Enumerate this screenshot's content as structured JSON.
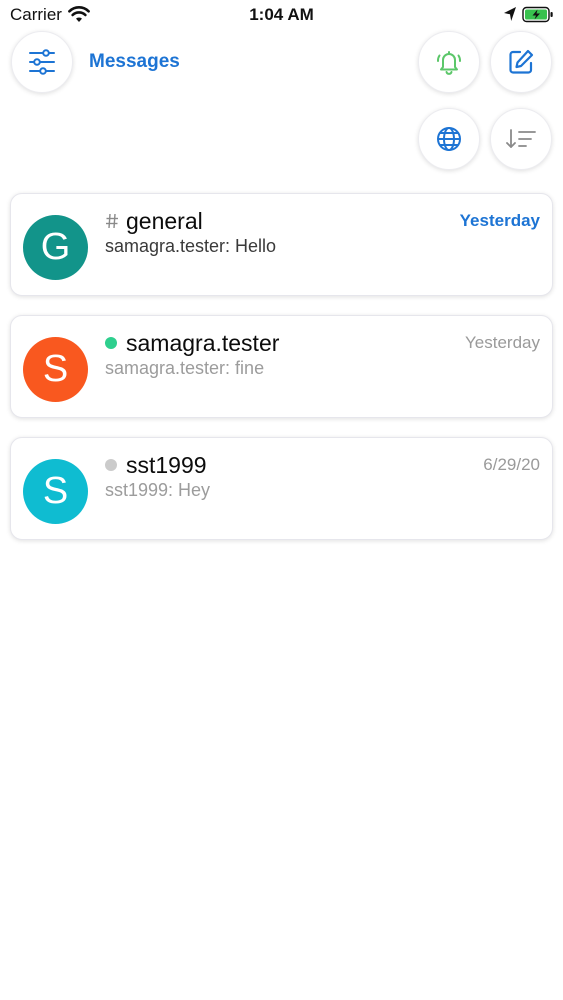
{
  "status_bar": {
    "carrier": "Carrier",
    "time": "1:04 AM",
    "icons": [
      "wifi-icon",
      "location-arrow-icon",
      "battery-charging-icon"
    ]
  },
  "header": {
    "title": "Messages",
    "buttons": [
      {
        "name": "filter",
        "icon": "sliders-icon"
      },
      {
        "name": "notifications",
        "icon": "bell-ringing-icon",
        "color": "#5cc76a"
      },
      {
        "name": "compose",
        "icon": "edit-icon"
      },
      {
        "name": "directory",
        "icon": "globe-icon"
      },
      {
        "name": "sort",
        "icon": "sort-down-icon"
      }
    ]
  },
  "colors": {
    "accent": "#1d74d4",
    "online": "#2ecf8e",
    "offline": "#cbcbcb",
    "bell": "#5cc76a"
  },
  "rooms": [
    {
      "name": "general",
      "prefix": "hash",
      "avatar_letter": "G",
      "avatar_color": "#12948a",
      "last_message": "samagra.tester: Hello",
      "time": "Yesterday",
      "unread": true
    },
    {
      "name": "samagra.tester",
      "prefix": "status-online",
      "avatar_letter": "S",
      "avatar_color": "#f9581f",
      "last_message": "samagra.tester: fine",
      "time": "Yesterday",
      "unread": false
    },
    {
      "name": "sst1999",
      "prefix": "status-offline",
      "avatar_letter": "S",
      "avatar_color": "#0fbcd1",
      "last_message": "sst1999: Hey",
      "time": "6/29/20",
      "unread": false
    }
  ]
}
